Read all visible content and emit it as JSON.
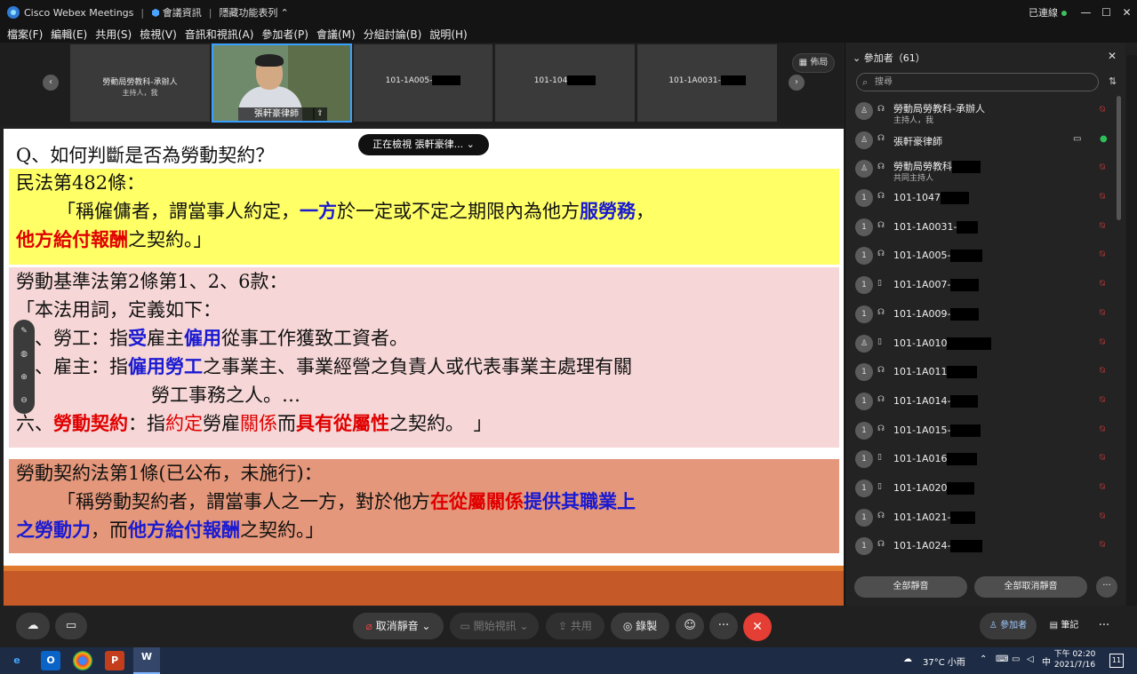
{
  "titlebar": {
    "app": "Cisco Webex Meetings",
    "meeting_info": "會議資訊",
    "hide_menu": "隱藏功能表列",
    "connection": "已連線",
    "min": "—",
    "max": "☐",
    "close": "✕"
  },
  "menu": [
    "檔案(F)",
    "編輯(E)",
    "共用(S)",
    "檢視(V)",
    "音訊和視訊(A)",
    "參加者(P)",
    "會議(M)",
    "分組討論(B)",
    "說明(H)"
  ],
  "strip": {
    "host_name": "勞動局勞教科-承辦人",
    "host_role": "主持人，我",
    "speaker_name": "張軒豪律師",
    "tile3": "101-1A005-",
    "tile4": "101-104",
    "tile5": "101-1A0031-",
    "layout_label": "佈局"
  },
  "viewing_label": "正在檢視 張軒豪律...",
  "slide": {
    "question": "Q、如何判斷是否為勞動契約？",
    "civil_title": "民法第482條：",
    "civil_l1_a": "「稱僱傭者，謂當事人約定，",
    "civil_l1_b": "一方",
    "civil_l1_c": "於一定或不定之期限內為他方",
    "civil_l1_d": "服勞務",
    "civil_l1_e": "，",
    "civil_l2_a": "他方給付報酬",
    "civil_l2_b": "之契約。」",
    "lsa_title": "勞動基準法第2條第1、2、6款：",
    "lsa_l1": "「本法用詞，定義如下：",
    "lsa_l2_a": "一、勞工：指",
    "lsa_l2_b": "受",
    "lsa_l2_c": "雇主",
    "lsa_l2_d": "僱用",
    "lsa_l2_e": "從事工作獲致工資者。",
    "lsa_l3_a": "二、雇主：指",
    "lsa_l3_b": "僱用勞工",
    "lsa_l3_c": "之事業主、事業經營之負責人或代表事業主處理有關",
    "lsa_l4": "勞工事務之人。…",
    "lsa_l5_a": "六、",
    "lsa_l5_b": "勞動契約",
    "lsa_l5_c": "：指",
    "lsa_l5_d": "約定",
    "lsa_l5_e": "勞雇",
    "lsa_l5_f": "關係",
    "lsa_l5_g": "而",
    "lsa_l5_h": "具有從屬性",
    "lsa_l5_i": "之契約。　」",
    "lca_title": "勞動契約法第1條(已公布，未施行)：",
    "lca_l1_a": "「稱勞動契約者，謂當事人之一方，對於他方",
    "lca_l1_b": "在從屬關係",
    "lca_l1_c": "提供其職業上",
    "lca_l2_a": "之勞動力",
    "lca_l2_b": "，而",
    "lca_l2_c": "他方給付報酬",
    "lca_l2_d": "之契約。」"
  },
  "panel": {
    "header": "參加者（61）",
    "search_placeholder": "搜尋",
    "participants": [
      {
        "name": "勞動局勞教科-承辦人",
        "sub": "主持人，我",
        "avatar": "",
        "redact": 0
      },
      {
        "name": "張軒豪律師",
        "sub": "",
        "avatar": "",
        "redact": 0,
        "active": true
      },
      {
        "name": "勞動局勞教科",
        "sub": "共同主持人",
        "avatar": "",
        "redact": 40
      },
      {
        "name": "101-1047",
        "sub": "",
        "avatar": "1",
        "redact": 40
      },
      {
        "name": "101-1A0031-",
        "sub": "",
        "avatar": "1",
        "redact": 30
      },
      {
        "name": "101-1A005-",
        "sub": "",
        "avatar": "1",
        "redact": 45
      },
      {
        "name": "101-1A007-",
        "sub": "",
        "avatar": "1",
        "redact": 40
      },
      {
        "name": "101-1A009-",
        "sub": "",
        "avatar": "1",
        "redact": 40
      },
      {
        "name": "101-1A010",
        "sub": "",
        "avatar": "",
        "redact": 62
      },
      {
        "name": "101-1A011",
        "sub": "",
        "avatar": "1",
        "redact": 42
      },
      {
        "name": "101-1A014-",
        "sub": "",
        "avatar": "1",
        "redact": 38
      },
      {
        "name": "101-1A015-",
        "sub": "",
        "avatar": "1",
        "redact": 42
      },
      {
        "name": "101-1A016",
        "sub": "",
        "avatar": "1",
        "redact": 42
      },
      {
        "name": "101-1A020",
        "sub": "",
        "avatar": "1",
        "redact": 38
      },
      {
        "name": "101-1A021-",
        "sub": "",
        "avatar": "1",
        "redact": 35
      },
      {
        "name": "101-1A024-",
        "sub": "",
        "avatar": "1",
        "redact": 45
      }
    ],
    "mute_all": "全部靜音",
    "unmute_all": "全部取消靜音"
  },
  "controls": {
    "unmute": "取消靜音",
    "video": "開始視訊",
    "share": "共用",
    "record": "錄製",
    "participants": "參加者",
    "notes": "筆記"
  },
  "taskbar": {
    "weather": "37°C 小雨",
    "time": "下午 02:20",
    "date": "2021/7/16",
    "notif": "11"
  }
}
